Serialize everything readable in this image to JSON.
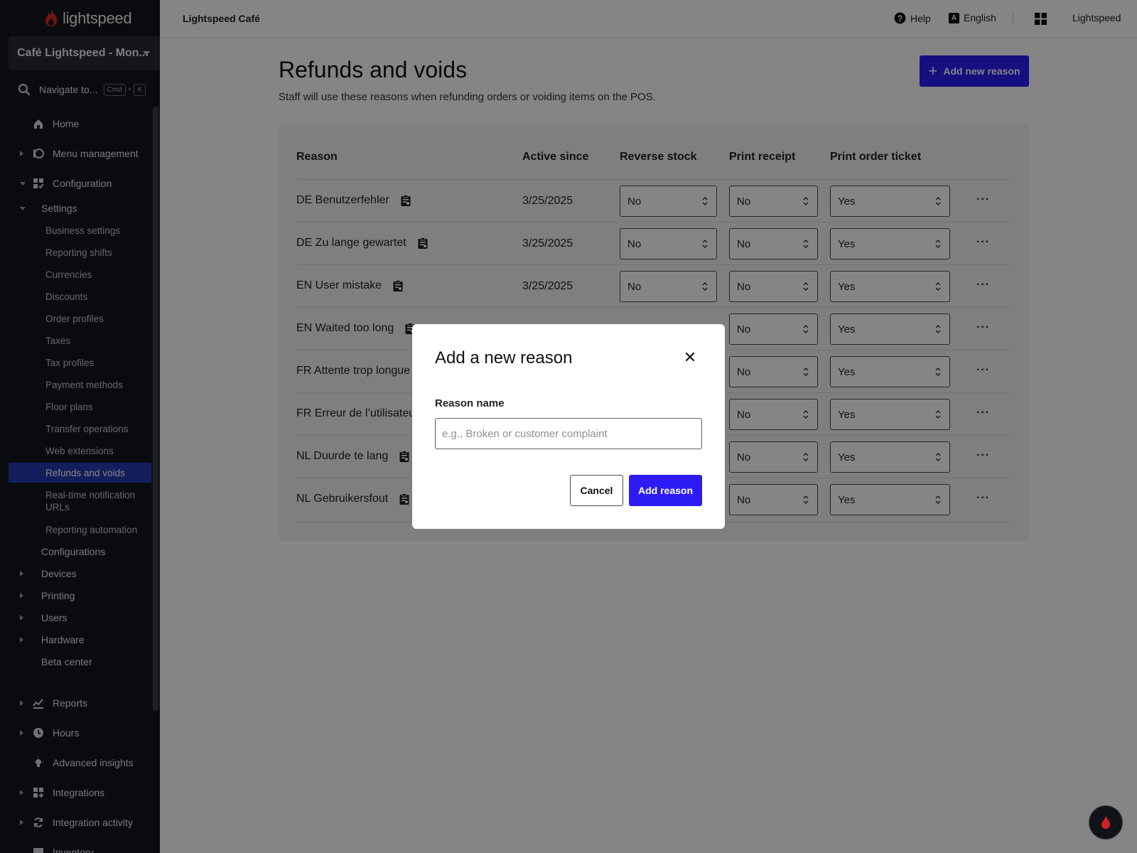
{
  "sidebar": {
    "logo_text": "lightspeed",
    "store": "Café Lightspeed - Mon...",
    "search_label": "Navigate to...",
    "search_kbd_1": "Cmd",
    "search_kbd_plus": "+",
    "search_kbd_2": "K",
    "items": {
      "home": "Home",
      "menu_management": "Menu management",
      "configuration": "Configuration",
      "settings": "Settings",
      "business_settings": "Business settings",
      "reporting_shifts": "Reporting shifts",
      "currencies": "Currencies",
      "discounts": "Discounts",
      "order_profiles": "Order profiles",
      "taxes": "Taxes",
      "tax_profiles": "Tax profiles",
      "payment_methods": "Payment methods",
      "floor_plans": "Floor plans",
      "transfer_operations": "Transfer operations",
      "web_extensions": "Web extensions",
      "refunds_and_voids": "Refunds and voids",
      "realtime_urls_line1": "Real-time notification",
      "realtime_urls_line2": "URLs",
      "reporting_automation": "Reporting automation",
      "configurations": "Configurations",
      "devices": "Devices",
      "printing": "Printing",
      "users": "Users",
      "hardware": "Hardware",
      "beta_center": "Beta center",
      "reports": "Reports",
      "hours": "Hours",
      "advanced_insights": "Advanced insights",
      "integrations": "Integrations",
      "integration_activity": "Integration activity",
      "inventory": "Inventory"
    }
  },
  "topbar": {
    "app_name": "Lightspeed Café",
    "help": "Help",
    "language_badge": "A",
    "language": "English",
    "account": "Lightspeed"
  },
  "page": {
    "title": "Refunds and voids",
    "subtitle": "Staff will use these reasons when refunding orders or voiding items on the POS.",
    "add_button": "Add new reason"
  },
  "table": {
    "headers": {
      "reason": "Reason",
      "active_since": "Active since",
      "reverse_stock": "Reverse stock",
      "print_receipt": "Print receipt",
      "print_order_ticket": "Print order ticket"
    },
    "rows": [
      {
        "reason": "DE Benutzerfehler",
        "date": "3/25/2025",
        "reverse_stock": "No",
        "print_receipt": "No",
        "print_order_ticket": "Yes"
      },
      {
        "reason": "DE Zu lange gewartet",
        "date": "3/25/2025",
        "reverse_stock": "No",
        "print_receipt": "No",
        "print_order_ticket": "Yes"
      },
      {
        "reason": "EN User mistake",
        "date": "3/25/2025",
        "reverse_stock": "No",
        "print_receipt": "No",
        "print_order_ticket": "Yes"
      },
      {
        "reason": "EN Waited too long",
        "date": "",
        "reverse_stock": "",
        "print_receipt": "No",
        "print_order_ticket": "Yes"
      },
      {
        "reason": "FR Attente trop longue",
        "date": "",
        "reverse_stock": "",
        "print_receipt": "No",
        "print_order_ticket": "Yes"
      },
      {
        "reason": "FR Erreur de l’utilisateu",
        "date": "",
        "reverse_stock": "",
        "print_receipt": "No",
        "print_order_ticket": "Yes"
      },
      {
        "reason": "NL Duurde te lang",
        "date": "",
        "reverse_stock": "",
        "print_receipt": "No",
        "print_order_ticket": "Yes"
      },
      {
        "reason": "NL Gebruikersfout",
        "date": "",
        "reverse_stock": "",
        "print_receipt": "No",
        "print_order_ticket": "Yes"
      }
    ]
  },
  "modal": {
    "title": "Add a new reason",
    "field_label": "Reason name",
    "field_value": "",
    "field_placeholder": "e.g., Broken or customer complaint",
    "cancel": "Cancel",
    "confirm": "Add reason"
  },
  "colors": {
    "primary": "#2d1bf6",
    "sidebar_bg": "#13161d",
    "sidebar_active": "#2a3bb0",
    "logo_red": "#e4262c"
  }
}
